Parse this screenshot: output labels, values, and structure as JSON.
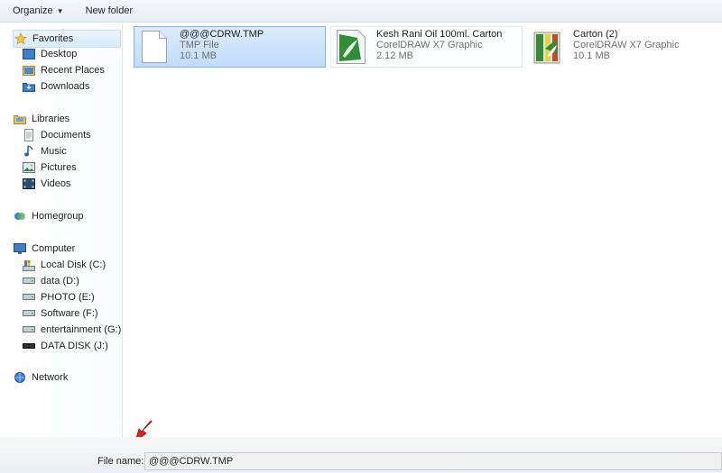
{
  "toolbar": {
    "organize": "Organize",
    "new_folder": "New folder"
  },
  "nav": {
    "favorites": {
      "label": "Favorites",
      "items": [
        "Desktop",
        "Recent Places",
        "Downloads"
      ]
    },
    "libraries": {
      "label": "Libraries",
      "items": [
        "Documents",
        "Music",
        "Pictures",
        "Videos"
      ]
    },
    "homegroup": "Homegroup",
    "computer": {
      "label": "Computer",
      "items": [
        "Local Disk (C:)",
        "data  (D:)",
        "PHOTO (E:)",
        "Software (F:)",
        "entertainment (G:)",
        "DATA DISK (J:)"
      ]
    },
    "network": "Network"
  },
  "files": [
    {
      "name": "@@@CDRW.TMP",
      "type": "TMP File",
      "size": "10.1 MB",
      "icon": "blank-file-icon"
    },
    {
      "name": "Kesh Rani Oil 100ml. Carton",
      "type": "CorelDRAW X7 Graphic",
      "size": "2.12 MB",
      "icon": "coreldraw-icon"
    },
    {
      "name": "Carton (2)",
      "type": "CorelDRAW X7 Graphic",
      "size": "10.1 MB",
      "icon": "coreldraw-thumbnail-icon"
    }
  ],
  "bottom": {
    "file_name_label": "File name:",
    "file_name_value": "@@@CDRW.TMP"
  }
}
